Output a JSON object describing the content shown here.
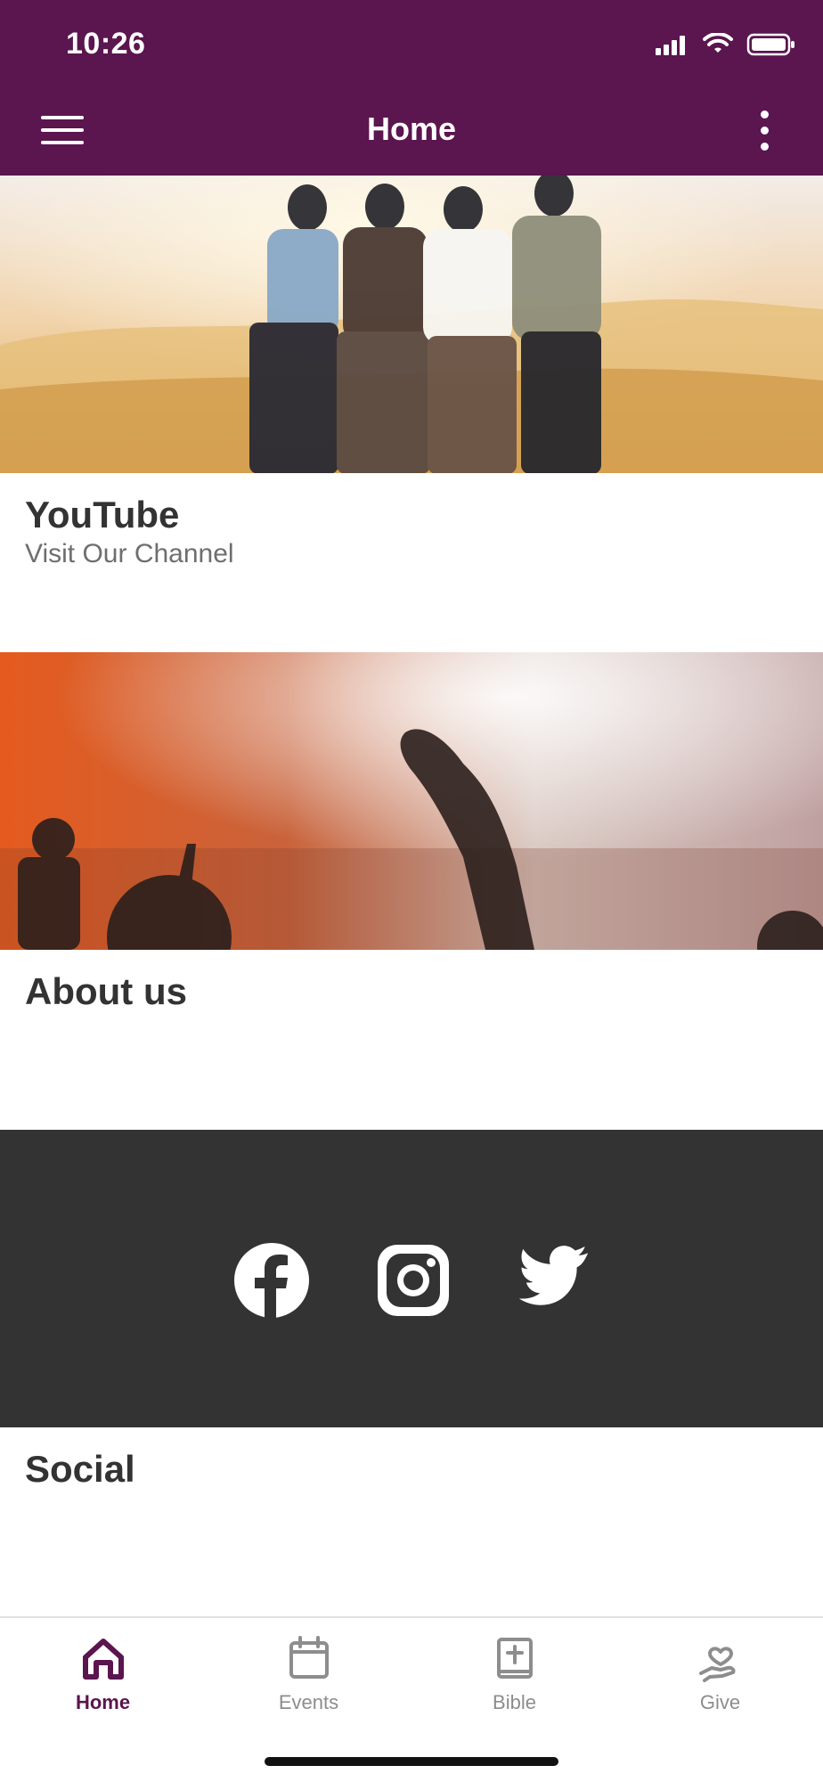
{
  "status_bar": {
    "time": "10:26",
    "icons": [
      "signal-icon",
      "wifi-icon",
      "battery-icon"
    ]
  },
  "header": {
    "title": "Home",
    "menu_icon": "hamburger-menu-icon",
    "more_icon": "vertical-ellipsis-icon"
  },
  "cards": [
    {
      "title": "YouTube",
      "subtitle": "Visit Our Channel",
      "image": "friends-sunset-photo"
    },
    {
      "title": "About us",
      "image": "worship-concert-photo"
    },
    {
      "title": "Social",
      "image": "social-icons-banner",
      "social_icons": [
        "facebook-icon",
        "instagram-icon",
        "twitter-icon"
      ]
    }
  ],
  "bottom_nav": {
    "items": [
      {
        "label": "Home",
        "icon": "home-icon",
        "active": true
      },
      {
        "label": "Events",
        "icon": "calendar-icon",
        "active": false
      },
      {
        "label": "Bible",
        "icon": "bible-icon",
        "active": false
      },
      {
        "label": "Give",
        "icon": "give-heart-hand-icon",
        "active": false
      }
    ]
  },
  "colors": {
    "brand": "#5b154f",
    "social_banner": "#333333",
    "text_dark": "#333333",
    "text_muted": "#6e6e6e",
    "nav_inactive": "#8d8d8d"
  }
}
